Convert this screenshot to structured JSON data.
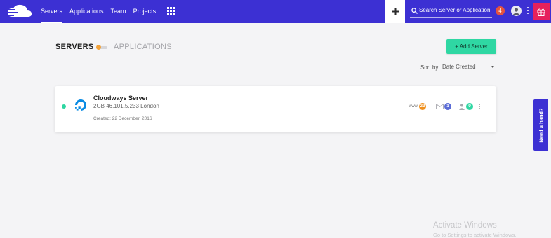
{
  "header": {
    "nav": [
      "Servers",
      "Applications",
      "Team",
      "Projects"
    ],
    "search_placeholder": "Search Server or Application",
    "notification_count": "4",
    "colors": {
      "bar": "#3c30d3",
      "gift": "#e6215c",
      "notif": "#e5533d"
    }
  },
  "page": {
    "tab_servers": "SERVERS",
    "tab_applications": "APPLICATIONS",
    "add_server_label": "+ Add Server",
    "sort_label": "Sort by",
    "sort_value": "Date Created"
  },
  "server": {
    "name": "Cloudways Server",
    "meta": "2GB  46.101.5.233  London",
    "created": "Created: 22 December, 2016",
    "www_label": "www",
    "www_count": "23",
    "mail_count": "1",
    "users_count": "0",
    "status": "running"
  },
  "help_label": "Need a hand?",
  "watermark": {
    "title": "Activate Windows",
    "subtitle": "Go to Settings to activate Windows."
  }
}
